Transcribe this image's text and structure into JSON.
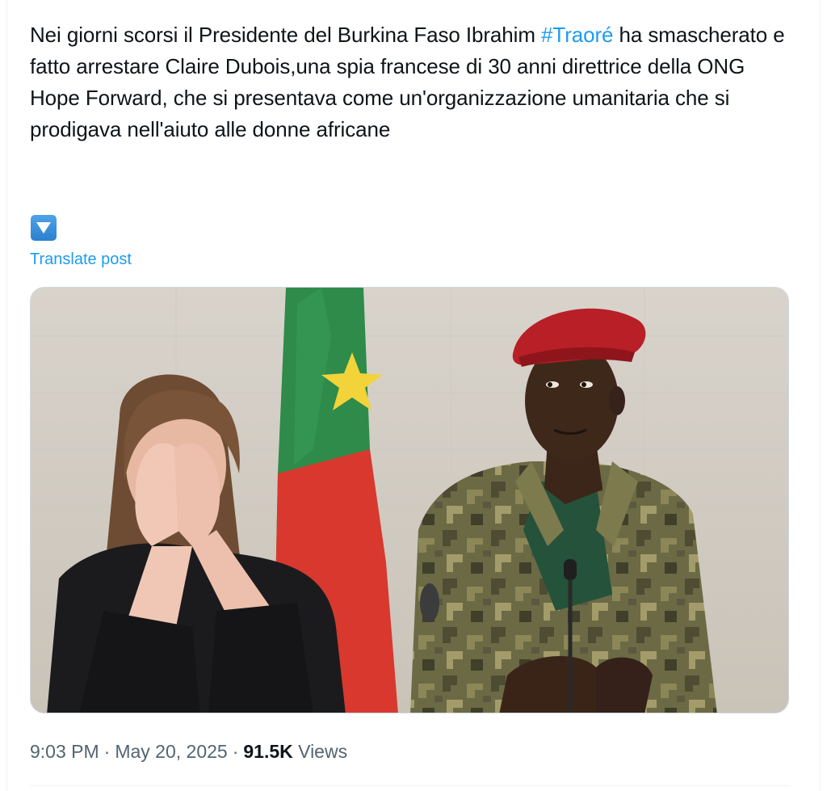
{
  "post": {
    "text_before_hashtag": "Nei giorni scorsi il Presidente del Burkina Faso Ibrahim ",
    "hashtag": "#Traoré",
    "text_after_hashtag": " ha smascherato e fatto arrestare Claire Dubois,una spia francese di 30 anni direttrice della ONG Hope Forward, che si presentava come un'organizzazione umanitaria che si prodigava nell'aiuto alle donne africane",
    "emoji_icon": "down-button-emoji",
    "translate_label": "Translate post"
  },
  "meta": {
    "time": "9:03 PM",
    "separator": "·",
    "date": "May 20, 2025",
    "views_count": "91.5K",
    "views_label": "Views"
  },
  "colors": {
    "link": "#1d9bf0",
    "text": "#0f1419",
    "secondary": "#536471",
    "border": "#eff3f4"
  }
}
